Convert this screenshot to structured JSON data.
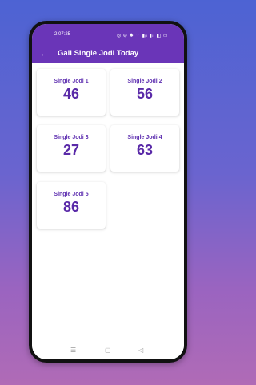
{
  "status": {
    "time": "2:07:25",
    "icons": "◎ ⊖ ✱ ⌔ ▮ᵢₗ ▮ₗₗ ◧ ▭"
  },
  "appbar": {
    "title": "Gali Single Jodi Today"
  },
  "cards": [
    {
      "label": "Single Jodi 1",
      "value": "46"
    },
    {
      "label": "Single Jodi 2",
      "value": "56"
    },
    {
      "label": "Single Jodi 3",
      "value": "27"
    },
    {
      "label": "Single Jodi 4",
      "value": "63"
    },
    {
      "label": "Single Jodi 5",
      "value": "86"
    }
  ],
  "colors": {
    "primary": "#6a35b8",
    "text_accent": "#5a2aa8"
  },
  "icons": {
    "back": "arrow-left-icon",
    "nav_menu": "menu-icon",
    "nav_home": "home-square-icon",
    "nav_back": "triangle-back-icon"
  }
}
